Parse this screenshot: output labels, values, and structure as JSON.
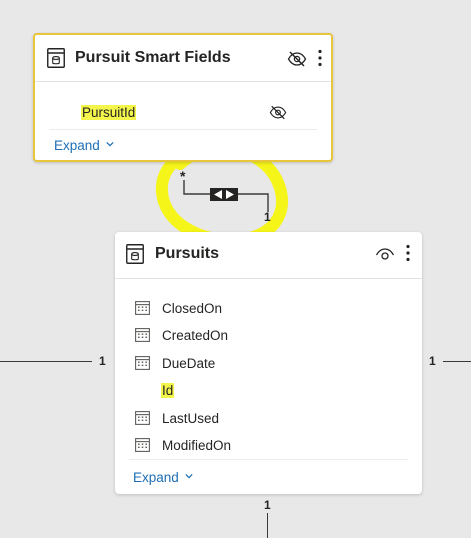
{
  "smart_fields_card": {
    "title": "Pursuit Smart Fields",
    "fields": [
      {
        "label": "PursuitId",
        "highlighted": true,
        "hidden": true,
        "icon": "none"
      }
    ],
    "expand_label": "Expand",
    "header_visibility_icon": "eye-slash-icon",
    "border_color": "#e8c53a"
  },
  "pursuits_card": {
    "title": "Pursuits",
    "header_visibility_icon": "eye-icon",
    "fields": [
      {
        "label": "ClosedOn",
        "icon": "calendar-icon",
        "highlighted": false
      },
      {
        "label": "CreatedOn",
        "icon": "calendar-icon",
        "highlighted": false
      },
      {
        "label": "DueDate",
        "icon": "calendar-icon",
        "highlighted": false
      },
      {
        "label": "Id",
        "icon": "none",
        "highlighted": true
      },
      {
        "label": "LastUsed",
        "icon": "calendar-icon",
        "highlighted": false
      },
      {
        "label": "ModifiedOn",
        "icon": "calendar-icon",
        "highlighted": false
      }
    ],
    "expand_label": "Expand"
  },
  "relationship": {
    "many_label": "*",
    "one_label": "1",
    "direction_icon": "bidirectional-arrows-icon",
    "annotation_color": "#f5f51a"
  },
  "connector_labels": {
    "left": "1",
    "right": "1",
    "bottom": "1"
  },
  "colors": {
    "canvas": "#e8e8e8",
    "highlight": "#f4f54a",
    "link": "#1f6fb5"
  }
}
